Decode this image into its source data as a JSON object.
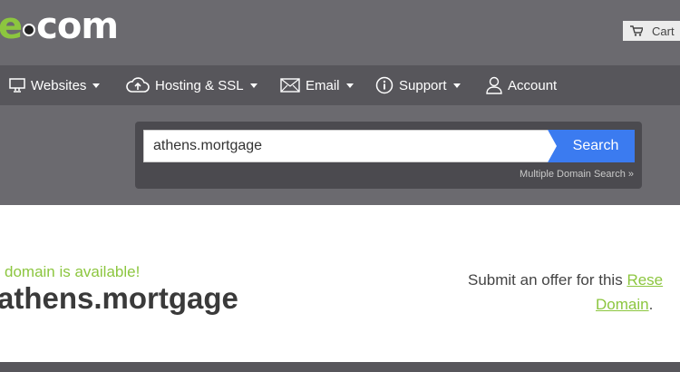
{
  "header": {
    "logo_prefix": "e",
    "logo_suffix": "com",
    "cart_label": "Cart"
  },
  "nav": {
    "items": [
      {
        "label": "Websites",
        "icon": "monitor-icon",
        "has_caret": true
      },
      {
        "label": "Hosting & SSL",
        "icon": "cloud-upload-icon",
        "has_caret": true
      },
      {
        "label": "Email",
        "icon": "envelope-icon",
        "has_caret": true
      },
      {
        "label": "Support",
        "icon": "info-icon",
        "has_caret": true
      },
      {
        "label": "Account",
        "icon": "user-icon",
        "has_caret": false
      }
    ]
  },
  "search": {
    "value": "athens.mortgage",
    "button_label": "Search",
    "multiple_link": "Multiple Domain Search »"
  },
  "result": {
    "availability_text": "is domain is available!",
    "domain": "athens.mortgage",
    "offer_text": "Submit an offer for this ",
    "offer_link_1": "Rese",
    "offer_link_2": "Domain",
    "offer_end": "."
  },
  "colors": {
    "accent_green": "#8cc63f",
    "search_blue": "#3b7bf0",
    "header_gray": "#6b6a6f",
    "nav_gray": "#57565b"
  }
}
